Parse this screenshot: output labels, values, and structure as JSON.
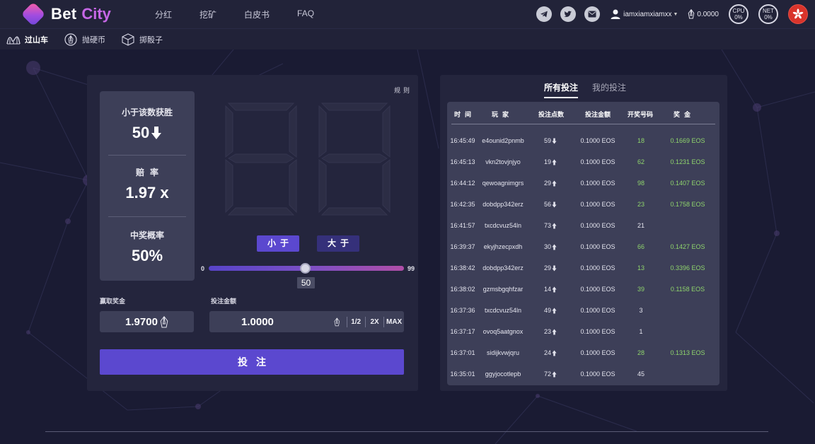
{
  "brand": {
    "name_part1": "Bet",
    "name_part2": "City",
    "accent": "#c667e6"
  },
  "nav": {
    "links": [
      "分红",
      "挖矿",
      "白皮书",
      "FAQ"
    ]
  },
  "header_right": {
    "social_icons": [
      "telegram-icon",
      "twitter-icon",
      "email-icon"
    ],
    "username": "iamxiamxiamxx",
    "balance": "0.0000",
    "cpu_label": "CPU",
    "cpu_value": "0%",
    "net_label": "NET",
    "net_value": "0%",
    "language_flag": "hong-kong-flag-icon"
  },
  "subnav": {
    "items": [
      {
        "label": "过山车",
        "icon": "roller-coaster-icon",
        "active": true
      },
      {
        "label": "抛硬币",
        "icon": "coin-icon",
        "active": false
      },
      {
        "label": "掷骰子",
        "icon": "dice-icon",
        "active": false
      }
    ]
  },
  "game": {
    "rules_label": "规则",
    "display_value": "88",
    "stats": {
      "win_condition_label": "小于该数获胜",
      "win_condition_value": "50",
      "odds_label": "赔率",
      "odds_value": "1.97 x",
      "win_chance_label": "中奖概率",
      "win_chance_value": "50%"
    },
    "btn_small": "小于",
    "btn_big": "大于",
    "slider": {
      "min": "0",
      "max": "99",
      "value": "50"
    },
    "payout_label": "赢取奖金",
    "payout_value": "1.9700",
    "bet_label": "投注金额",
    "bet_value": "1.0000",
    "bet_options": [
      "1/2",
      "2X",
      "MAX"
    ],
    "place_bet_label": "投注"
  },
  "bets": {
    "tabs": [
      "所有投注",
      "我的投注"
    ],
    "columns": [
      "时间",
      "玩家",
      "投注点数",
      "投注金额",
      "开奖号码",
      "奖金"
    ],
    "rows": [
      {
        "time": "16:45:49",
        "player": "e4ounid2pnmb",
        "roll": "59",
        "dir": "down",
        "amount": "0.1000 EOS",
        "result": "18",
        "payout": "0.1669 EOS",
        "win": true
      },
      {
        "time": "16:45:13",
        "player": "vkn2tovjnjyo",
        "roll": "19",
        "dir": "up",
        "amount": "0.1000 EOS",
        "result": "62",
        "payout": "0.1231 EOS",
        "win": true
      },
      {
        "time": "16:44:12",
        "player": "qewoagnimgrs",
        "roll": "29",
        "dir": "up",
        "amount": "0.1000 EOS",
        "result": "98",
        "payout": "0.1407 EOS",
        "win": true
      },
      {
        "time": "16:42:35",
        "player": "dobdpp342erz",
        "roll": "56",
        "dir": "down",
        "amount": "0.1000 EOS",
        "result": "23",
        "payout": "0.1758 EOS",
        "win": true
      },
      {
        "time": "16:41:57",
        "player": "txcdcvuz54ln",
        "roll": "73",
        "dir": "up",
        "amount": "0.1000 EOS",
        "result": "21",
        "payout": "",
        "win": false
      },
      {
        "time": "16:39:37",
        "player": "ekyjhzecpxdh",
        "roll": "30",
        "dir": "up",
        "amount": "0.1000 EOS",
        "result": "66",
        "payout": "0.1427 EOS",
        "win": true
      },
      {
        "time": "16:38:42",
        "player": "dobdpp342erz",
        "roll": "29",
        "dir": "down",
        "amount": "0.1000 EOS",
        "result": "13",
        "payout": "0.3396 EOS",
        "win": true
      },
      {
        "time": "16:38:02",
        "player": "gzmsbgqhfzar",
        "roll": "14",
        "dir": "up",
        "amount": "0.1000 EOS",
        "result": "39",
        "payout": "0.1158 EOS",
        "win": true
      },
      {
        "time": "16:37:36",
        "player": "txcdcvuz54ln",
        "roll": "49",
        "dir": "up",
        "amount": "0.1000 EOS",
        "result": "3",
        "payout": "",
        "win": false
      },
      {
        "time": "16:37:17",
        "player": "ovoq5aatgnox",
        "roll": "23",
        "dir": "up",
        "amount": "0.1000 EOS",
        "result": "1",
        "payout": "",
        "win": false
      },
      {
        "time": "16:37:01",
        "player": "sidijkvwjqru",
        "roll": "24",
        "dir": "up",
        "amount": "0.1000 EOS",
        "result": "28",
        "payout": "0.1313 EOS",
        "win": true
      },
      {
        "time": "16:35:01",
        "player": "ggyjocotlepb",
        "roll": "72",
        "dir": "up",
        "amount": "0.1000 EOS",
        "result": "45",
        "payout": "",
        "win": false
      }
    ]
  },
  "colors": {
    "page_bg": "#1a1b33",
    "panel_bg": "#24253d",
    "card_bg": "#3d3f58",
    "primary_button": "#5b48cf",
    "secondary_button": "#35307a",
    "win_green": "#8fd46c"
  }
}
